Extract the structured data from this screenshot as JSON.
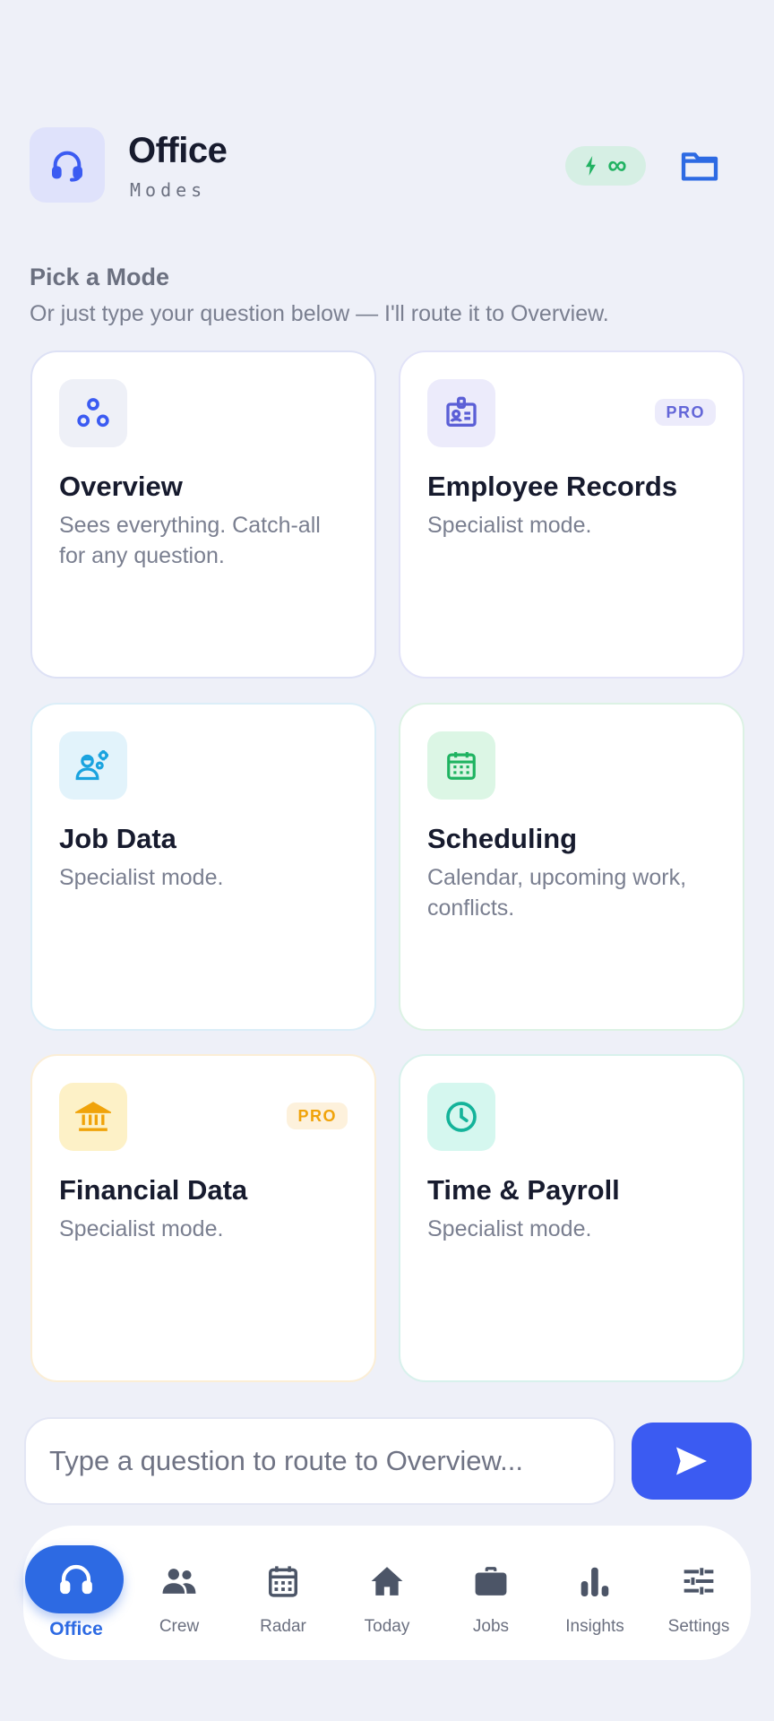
{
  "header": {
    "title": "Office",
    "subtitle": "Modes",
    "badge_symbol": "∞",
    "icon": "headset-icon",
    "folder_icon": "folder-icon",
    "accent": "#3b5bf2"
  },
  "intro": {
    "title": "Pick a Mode",
    "subtitle": "Or just type your question below — I'll route it to Overview."
  },
  "modes": [
    {
      "title": "Overview",
      "desc": "Sees everything. Catch-all for any question.",
      "icon": "nodes-icon",
      "pro": ""
    },
    {
      "title": "Employee Records",
      "desc": "Specialist mode.",
      "icon": "id-badge-icon",
      "pro": "PRO"
    },
    {
      "title": "Job Data",
      "desc": "Specialist mode.",
      "icon": "worker-gear-icon",
      "pro": ""
    },
    {
      "title": "Scheduling",
      "desc": "Calendar, upcoming work, conflicts.",
      "icon": "calendar-icon",
      "pro": ""
    },
    {
      "title": "Financial Data",
      "desc": "Specialist mode.",
      "icon": "bank-icon",
      "pro": "PRO"
    },
    {
      "title": "Time & Payroll",
      "desc": "Specialist mode.",
      "icon": "clock-icon",
      "pro": ""
    }
  ],
  "input": {
    "placeholder": "Type a question to route to Overview...",
    "value": ""
  },
  "nav": [
    {
      "label": "Office",
      "icon": "headset-icon",
      "active": true
    },
    {
      "label": "Crew",
      "icon": "people-icon"
    },
    {
      "label": "Radar",
      "icon": "calendar-icon"
    },
    {
      "label": "Today",
      "icon": "home-icon"
    },
    {
      "label": "Jobs",
      "icon": "briefcase-icon"
    },
    {
      "label": "Insights",
      "icon": "bar-chart-icon"
    },
    {
      "label": "Settings",
      "icon": "sliders-icon"
    }
  ]
}
